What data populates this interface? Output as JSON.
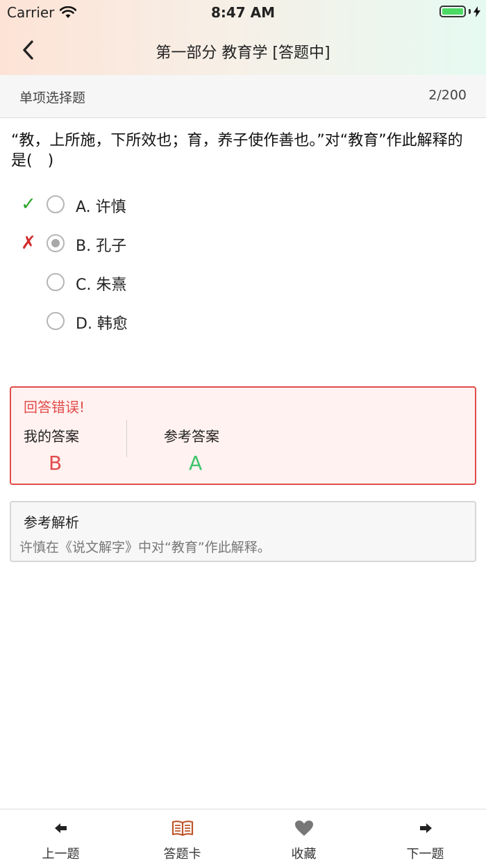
{
  "status_bar": {
    "carrier": "Carrier",
    "time": "8:47 AM"
  },
  "nav": {
    "title": "第一部分 教育学 [答题中]",
    "back_icon": "chevron-left-icon"
  },
  "question_header": {
    "type": "单项选择题",
    "progress": "2/200"
  },
  "question": {
    "text": "“教，上所施，下所效也；育，养子使作善也。”对“教育”作此解释的是(　)"
  },
  "options": [
    {
      "label": "A. 许慎",
      "mark": "✓",
      "mark_type": "correct",
      "selected": false
    },
    {
      "label": "B. 孔子",
      "mark": "✗",
      "mark_type": "wrong",
      "selected": true
    },
    {
      "label": "C. 朱熹",
      "mark": "",
      "mark_type": "none",
      "selected": false
    },
    {
      "label": "D. 韩愈",
      "mark": "",
      "mark_type": "none",
      "selected": false
    }
  ],
  "result": {
    "title": "回答错误!",
    "my_answer_label": "我的答案",
    "my_answer": "B",
    "reference_label": "参考答案",
    "reference_answer": "A",
    "error_color": "#e24b4b",
    "correct_color": "#3cc46a"
  },
  "analysis": {
    "title": "参考解析",
    "text": "许慎在《说文解字》中对“教育”作此解释。"
  },
  "tabbar": {
    "items": [
      {
        "label": "上一题",
        "icon": "arrow-left-icon"
      },
      {
        "label": "答题卡",
        "icon": "open-book-icon"
      },
      {
        "label": "收藏",
        "icon": "heart-icon"
      },
      {
        "label": "下一题",
        "icon": "arrow-right-icon"
      }
    ]
  },
  "colors": {
    "accent_book": "#c0562a",
    "header_gradient_left": "#fde3d6",
    "header_gradient_right": "#e6faf2"
  }
}
